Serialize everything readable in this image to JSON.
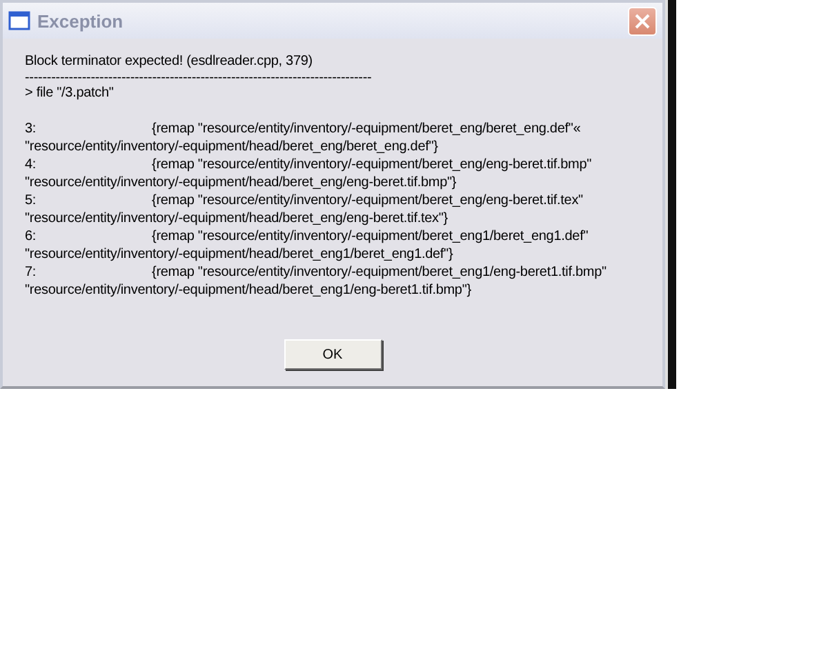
{
  "window": {
    "title": "Exception",
    "active": false
  },
  "message": "Block terminator expected! (esdlreader.cpp, 379)",
  "separator": "-------------------------------------------------------------------------------",
  "file_line": "> file \"/3.patch\"",
  "entries": [
    {
      "number": "3:",
      "command": "{remap \"resource/entity/inventory/-equipment/beret_eng/beret_eng.def\"«",
      "continuation": "\"resource/entity/inventory/-equipment/head/beret_eng/beret_eng.def\"}"
    },
    {
      "number": "4:",
      "command": "{remap \"resource/entity/inventory/-equipment/beret_eng/eng-beret.tif.bmp\"",
      "continuation": "\"resource/entity/inventory/-equipment/head/beret_eng/eng-beret.tif.bmp\"}"
    },
    {
      "number": "5:",
      "command": "{remap \"resource/entity/inventory/-equipment/beret_eng/eng-beret.tif.tex\"",
      "continuation": "\"resource/entity/inventory/-equipment/head/beret_eng/eng-beret.tif.tex\"}"
    },
    {
      "number": "6:",
      "command": "{remap \"resource/entity/inventory/-equipment/beret_eng1/beret_eng1.def\"",
      "continuation": "\"resource/entity/inventory/-equipment/head/beret_eng1/beret_eng1.def\"}"
    },
    {
      "number": "7:",
      "command": "{remap \"resource/entity/inventory/-equipment/beret_eng1/eng-beret1.tif.bmp\"",
      "continuation": "\"resource/entity/inventory/-equipment/head/beret_eng1/eng-beret1.tif.bmp\"}"
    }
  ],
  "button": "OK"
}
